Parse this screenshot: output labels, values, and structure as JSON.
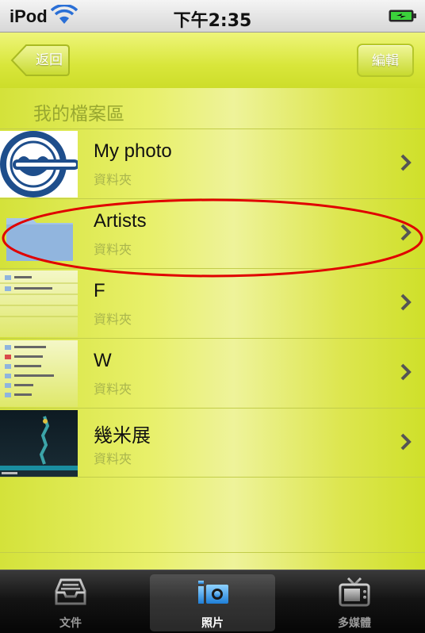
{
  "status": {
    "carrier": "iPod",
    "time": "下午2:35"
  },
  "nav": {
    "back_label": "返回",
    "edit_label": "編輯"
  },
  "section": {
    "title": "我的檔案區"
  },
  "folders": [
    {
      "name": "My photo",
      "subtitle": "資料夾",
      "thumb": "laughing-man-logo"
    },
    {
      "name": "Artists",
      "subtitle": "資料夾",
      "thumb": "folder"
    },
    {
      "name": "F",
      "subtitle": "資料夾",
      "thumb": "file-list-screenshot"
    },
    {
      "name": "W",
      "subtitle": "資料夾",
      "thumb": "file-list-screenshot"
    },
    {
      "name": "幾米展",
      "subtitle": "資料夾",
      "thumb": "dark-photo"
    }
  ],
  "tabs": [
    {
      "label": "文件",
      "icon": "inbox-tray-icon",
      "selected": false
    },
    {
      "label": "照片",
      "icon": "camera-icon",
      "selected": true
    },
    {
      "label": "多媒體",
      "icon": "tv-icon",
      "selected": false
    }
  ],
  "colors": {
    "accent": "#d8e63a",
    "annotation": "#e00000"
  }
}
